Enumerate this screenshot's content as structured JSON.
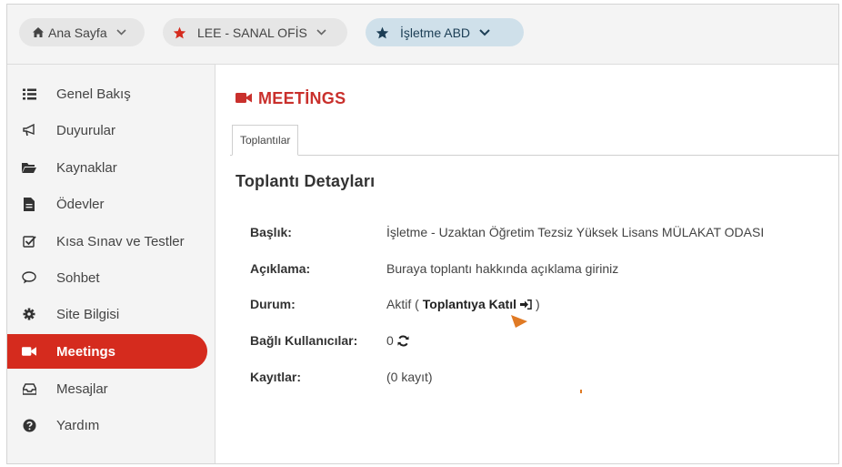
{
  "breadcrumbs": {
    "home": "Ana Sayfa",
    "site": "LEE - SANAL OFİS",
    "current": "İşletme ABD"
  },
  "sidebar": {
    "items": [
      {
        "label": "Genel Bakış",
        "icon": "list-icon"
      },
      {
        "label": "Duyurular",
        "icon": "bullhorn-icon"
      },
      {
        "label": "Kaynaklar",
        "icon": "folder-icon"
      },
      {
        "label": "Ödevler",
        "icon": "file-icon"
      },
      {
        "label": "Kısa Sınav ve Testler",
        "icon": "checkbox-icon"
      },
      {
        "label": "Sohbet",
        "icon": "chat-icon"
      },
      {
        "label": "Site Bilgisi",
        "icon": "gear-icon"
      },
      {
        "label": "Meetings",
        "icon": "video-icon",
        "active": true
      },
      {
        "label": "Mesajlar",
        "icon": "inbox-icon"
      },
      {
        "label": "Yardım",
        "icon": "help-icon"
      }
    ]
  },
  "main": {
    "title": "MEETİNGS",
    "tab": "Toplantılar",
    "section_title": "Toplantı Detayları",
    "details": {
      "title_key": "Başlık:",
      "title_value": "İşletme - Uzaktan Öğretim Tezsiz Yüksek Lisans MÜLAKAT ODASI",
      "desc_key": "Açıklama:",
      "desc_value": "Buraya toplantı hakkında açıklama giriniz",
      "status_key": "Durum:",
      "status_value": "Aktif (",
      "join_label": "Toplantıya Katıl",
      "status_close": ")",
      "users_key": "Bağlı Kullanıcılar:",
      "users_value": "0",
      "records_key": "Kayıtlar:",
      "records_value": "(0 kayıt)"
    }
  },
  "colors": {
    "accent_red": "#d52b1e",
    "title_red": "#c9302c",
    "active_pill": "#cfe0ea",
    "cursor_orange": "#e07a24"
  }
}
